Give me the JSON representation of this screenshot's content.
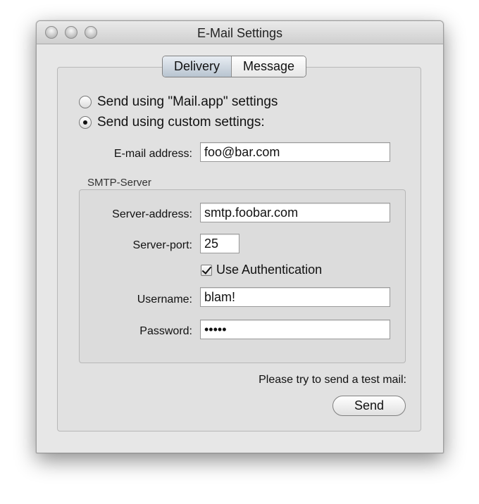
{
  "window": {
    "title": "E-Mail Settings"
  },
  "tabs": [
    {
      "label": "Delivery",
      "selected": true
    },
    {
      "label": "Message",
      "selected": false
    }
  ],
  "delivery": {
    "option_mail_app": "Send using \"Mail.app\" settings",
    "option_custom": "Send using custom settings:",
    "selected_option": "custom",
    "email_label": "E-mail address:",
    "email_value": "foo@bar.com"
  },
  "smtp": {
    "group_label": "SMTP-Server",
    "server_address_label": "Server-address:",
    "server_address_value": "smtp.foobar.com",
    "server_port_label": "Server-port:",
    "server_port_value": "25",
    "use_auth_label": "Use Authentication",
    "use_auth_checked": true,
    "username_label": "Username:",
    "username_value": "blam!",
    "password_label": "Password:",
    "password_value": "•••••"
  },
  "footer": {
    "hint": "Please try to send a test mail:",
    "send_label": "Send"
  }
}
